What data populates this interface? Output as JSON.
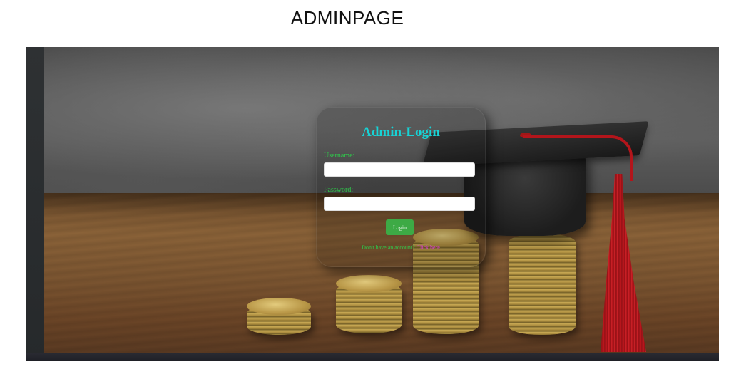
{
  "page": {
    "heading": "ADMINPAGE"
  },
  "login": {
    "title": "Admin-Login",
    "username_label": "Username:",
    "username_value": "",
    "password_label": "Password:",
    "password_value": "",
    "button_label": "Login",
    "signup_prompt": "Don't have an account?",
    "signup_link": "Click here"
  },
  "colors": {
    "title": "#17d3d6",
    "labels": "#2ec94a",
    "button": "#3daa45",
    "link": "#e23bd9"
  }
}
